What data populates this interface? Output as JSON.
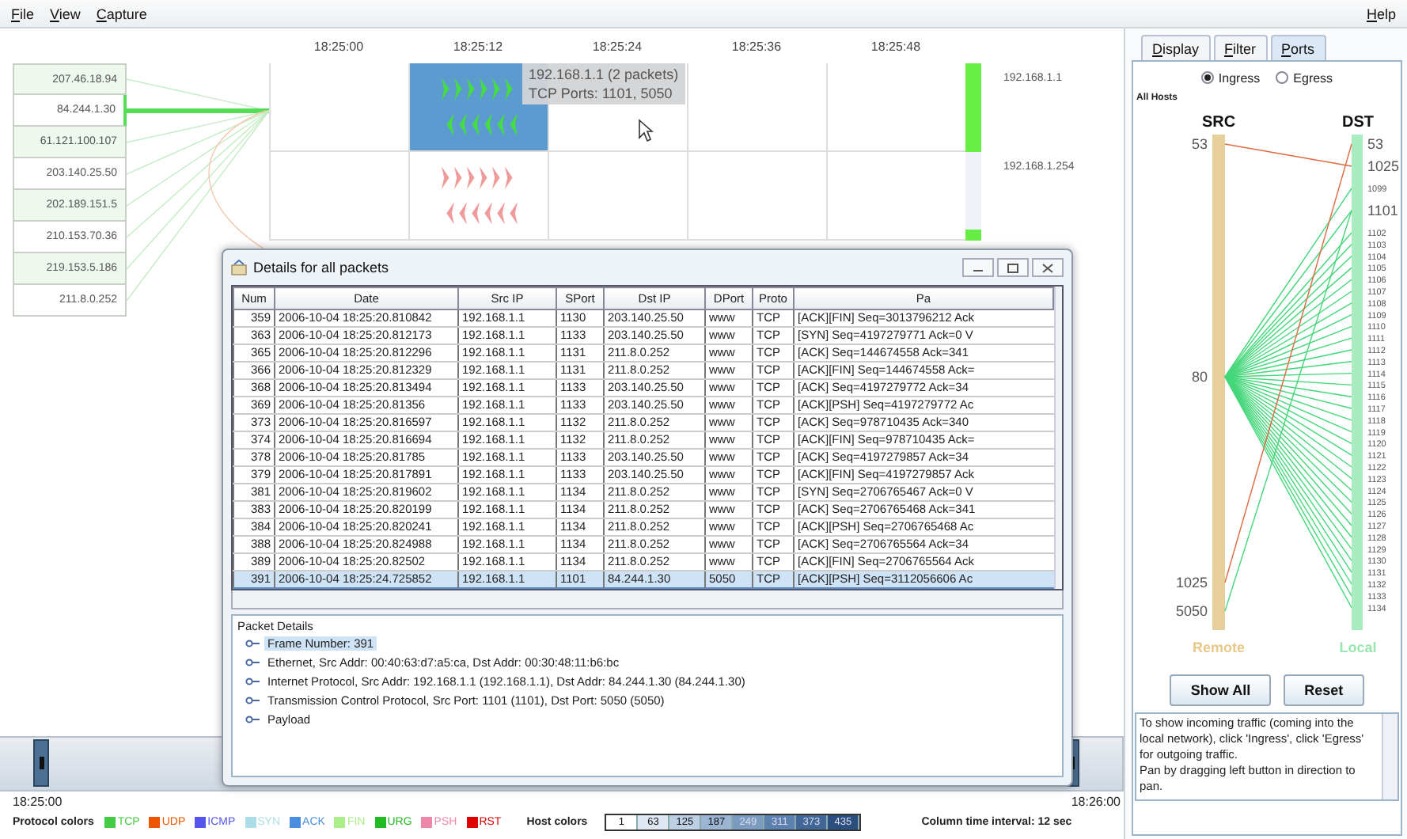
{
  "menu": [
    {
      "label": "File"
    },
    {
      "label": "View"
    },
    {
      "label": "Capture"
    }
  ],
  "help_menu": "Help",
  "hosts_list": [
    {
      "ip": "207.46.18.94",
      "selected": false
    },
    {
      "ip": "84.244.1.30",
      "selected": true
    },
    {
      "ip": "61.121.100.107",
      "selected": false
    },
    {
      "ip": "203.140.25.50",
      "selected": false
    },
    {
      "ip": "202.189.151.5",
      "selected": false
    },
    {
      "ip": "210.153.70.36",
      "selected": false
    },
    {
      "ip": "219.153.5.186",
      "selected": false
    },
    {
      "ip": "211.8.0.252",
      "selected": false
    }
  ],
  "timeline": {
    "time_labels": [
      "18:25:00",
      "18:25:12",
      "18:25:24",
      "18:25:36",
      "18:25:48"
    ],
    "tooltip": [
      "192.168.1.1  (2 packets)",
      "TCP Ports: 1101, 5050"
    ],
    "hosts": [
      {
        "label": "192.168.1.1",
        "color": "#44dd44",
        "level": 1,
        "cells": [
          {
            "kind": "empty",
            "highlighted": false
          },
          {
            "kind": "glyphs",
            "highlighted": true
          },
          {
            "kind": "empty",
            "highlighted": false
          },
          {
            "kind": "empty",
            "highlighted": false
          },
          {
            "kind": "empty",
            "highlighted": false
          }
        ]
      },
      {
        "label": "192.168.1.254",
        "color": "#f09a9a",
        "level": 0.12,
        "cells": [
          {
            "kind": "empty",
            "highlighted": false
          },
          {
            "kind": "glyphs",
            "highlighted": false
          },
          {
            "kind": "empty",
            "highlighted": false
          },
          {
            "kind": "empty",
            "highlighted": false
          },
          {
            "kind": "empty",
            "highlighted": false
          }
        ]
      }
    ]
  },
  "ports_panel": {
    "tabs": [
      {
        "label": "Display",
        "selected": false
      },
      {
        "label": "Filter",
        "selected": false
      },
      {
        "label": "Ports",
        "selected": true
      }
    ],
    "modes": [
      {
        "label": "Ingress",
        "selected": true
      },
      {
        "label": "Egress",
        "selected": false
      }
    ],
    "scope": "All Hosts",
    "src_title": "SRC",
    "dst_title": "DST",
    "src_caption": "Remote",
    "dst_caption": "Local",
    "src_ports": [
      "53",
      "80",
      "1025",
      "5050"
    ],
    "dst_ports": [
      {
        "label": "53",
        "major": true
      },
      {
        "label": "1025",
        "major": true
      },
      {
        "label": "1099",
        "major": false
      },
      {
        "label": "1101",
        "major": true
      },
      {
        "label": "1102",
        "major": false
      },
      {
        "label": "1103",
        "major": false
      },
      {
        "label": "1104",
        "major": false
      },
      {
        "label": "1105",
        "major": false
      },
      {
        "label": "1106",
        "major": false
      },
      {
        "label": "1107",
        "major": false
      },
      {
        "label": "1108",
        "major": false
      },
      {
        "label": "1109",
        "major": false
      },
      {
        "label": "1110",
        "major": false
      },
      {
        "label": "1111",
        "major": false
      },
      {
        "label": "1112",
        "major": false
      },
      {
        "label": "1113",
        "major": false
      },
      {
        "label": "1114",
        "major": false
      },
      {
        "label": "1115",
        "major": false
      },
      {
        "label": "1116",
        "major": false
      },
      {
        "label": "1117",
        "major": false
      },
      {
        "label": "1118",
        "major": false
      },
      {
        "label": "1119",
        "major": false
      },
      {
        "label": "1120",
        "major": false
      },
      {
        "label": "1121",
        "major": false
      },
      {
        "label": "1122",
        "major": false
      },
      {
        "label": "1123",
        "major": false
      },
      {
        "label": "1124",
        "major": false
      },
      {
        "label": "1125",
        "major": false
      },
      {
        "label": "1126",
        "major": false
      },
      {
        "label": "1127",
        "major": false
      },
      {
        "label": "1128",
        "major": false
      },
      {
        "label": "1129",
        "major": false
      },
      {
        "label": "1130",
        "major": false
      },
      {
        "label": "1131",
        "major": false
      },
      {
        "label": "1132",
        "major": false
      },
      {
        "label": "1133",
        "major": false
      },
      {
        "label": "1134",
        "major": false
      }
    ],
    "buttons": [
      "Show All",
      "Reset"
    ],
    "help": [
      "To show incoming traffic (coming into the local network), click 'Ingress', click 'Egress' for outgoing traffic.",
      "Pan by dragging left button in direction to pan."
    ]
  },
  "dialog": {
    "title": "Details for all packets",
    "columns": [
      "Num",
      "Date",
      "Src IP",
      "SPort",
      "Dst IP",
      "DPort",
      "Proto",
      "Pa"
    ],
    "rows": [
      {
        "cells": [
          "359",
          "2006-10-04 18:25:20.810842",
          "192.168.1.1",
          "1130",
          "203.140.25.50",
          "www",
          "TCP",
          "[ACK][FIN] Seq=3013796212 Ack"
        ],
        "selected": false
      },
      {
        "cells": [
          "363",
          "2006-10-04 18:25:20.812173",
          "192.168.1.1",
          "1133",
          "203.140.25.50",
          "www",
          "TCP",
          "[SYN] Seq=4197279771 Ack=0 V"
        ],
        "selected": false
      },
      {
        "cells": [
          "365",
          "2006-10-04 18:25:20.812296",
          "192.168.1.1",
          "1131",
          "211.8.0.252",
          "www",
          "TCP",
          "[ACK] Seq=144674558 Ack=341"
        ],
        "selected": false
      },
      {
        "cells": [
          "366",
          "2006-10-04 18:25:20.812329",
          "192.168.1.1",
          "1131",
          "211.8.0.252",
          "www",
          "TCP",
          "[ACK][FIN] Seq=144674558 Ack="
        ],
        "selected": false
      },
      {
        "cells": [
          "368",
          "2006-10-04 18:25:20.813494",
          "192.168.1.1",
          "1133",
          "203.140.25.50",
          "www",
          "TCP",
          "[ACK] Seq=4197279772 Ack=34"
        ],
        "selected": false
      },
      {
        "cells": [
          "369",
          "2006-10-04 18:25:20.81356",
          "192.168.1.1",
          "1133",
          "203.140.25.50",
          "www",
          "TCP",
          "[ACK][PSH] Seq=4197279772 Ac"
        ],
        "selected": false
      },
      {
        "cells": [
          "373",
          "2006-10-04 18:25:20.816597",
          "192.168.1.1",
          "1132",
          "211.8.0.252",
          "www",
          "TCP",
          "[ACK] Seq=978710435 Ack=340"
        ],
        "selected": false
      },
      {
        "cells": [
          "374",
          "2006-10-04 18:25:20.816694",
          "192.168.1.1",
          "1132",
          "211.8.0.252",
          "www",
          "TCP",
          "[ACK][FIN] Seq=978710435 Ack="
        ],
        "selected": false
      },
      {
        "cells": [
          "378",
          "2006-10-04 18:25:20.81785",
          "192.168.1.1",
          "1133",
          "203.140.25.50",
          "www",
          "TCP",
          "[ACK] Seq=4197279857 Ack=34"
        ],
        "selected": false
      },
      {
        "cells": [
          "379",
          "2006-10-04 18:25:20.817891",
          "192.168.1.1",
          "1133",
          "203.140.25.50",
          "www",
          "TCP",
          "[ACK][FIN] Seq=4197279857 Ack"
        ],
        "selected": false
      },
      {
        "cells": [
          "381",
          "2006-10-04 18:25:20.819602",
          "192.168.1.1",
          "1134",
          "211.8.0.252",
          "www",
          "TCP",
          "[SYN] Seq=2706765467 Ack=0 V"
        ],
        "selected": false
      },
      {
        "cells": [
          "383",
          "2006-10-04 18:25:20.820199",
          "192.168.1.1",
          "1134",
          "211.8.0.252",
          "www",
          "TCP",
          "[ACK] Seq=2706765468 Ack=341"
        ],
        "selected": false
      },
      {
        "cells": [
          "384",
          "2006-10-04 18:25:20.820241",
          "192.168.1.1",
          "1134",
          "211.8.0.252",
          "www",
          "TCP",
          "[ACK][PSH] Seq=2706765468 Ac"
        ],
        "selected": false
      },
      {
        "cells": [
          "388",
          "2006-10-04 18:25:20.824988",
          "192.168.1.1",
          "1134",
          "211.8.0.252",
          "www",
          "TCP",
          "[ACK] Seq=2706765564 Ack=34"
        ],
        "selected": false
      },
      {
        "cells": [
          "389",
          "2006-10-04 18:25:20.82502",
          "192.168.1.1",
          "1134",
          "211.8.0.252",
          "www",
          "TCP",
          "[ACK][FIN] Seq=2706765564 Ack"
        ],
        "selected": false
      },
      {
        "cells": [
          "391",
          "2006-10-04 18:25:24.725852",
          "192.168.1.1",
          "1101",
          "84.244.1.30",
          "5050",
          "TCP",
          "[ACK][PSH] Seq=3112056606 Ac"
        ],
        "selected": true
      }
    ],
    "details_title": "Packet Details",
    "details": [
      {
        "label": "Frame Number: 391",
        "selected": true
      },
      {
        "label": "Ethernet, Src Addr: 00:40:63:d7:a5:ca, Dst Addr: 00:30:48:11:b6:bc",
        "selected": false
      },
      {
        "label": "Internet Protocol, Src Addr: 192.168.1.1 (192.168.1.1), Dst Addr: 84.244.1.30 (84.244.1.30)",
        "selected": false
      },
      {
        "label": "Transmission Control Protocol, Src Port: 1101 (1101), Dst Port: 5050 (5050)",
        "selected": false
      },
      {
        "label": "Payload",
        "selected": false
      }
    ]
  },
  "range": {
    "start": "18:25:00",
    "end": "18:26:00",
    "handles": [
      {
        "level": 0.03
      },
      {
        "level": 0.96
      }
    ]
  },
  "legend": {
    "protocol_title": "Protocol colors",
    "protocols": [
      {
        "label": "TCP",
        "color": "#44cc44"
      },
      {
        "label": "UDP",
        "color": "#ee5500"
      },
      {
        "label": "ICMP",
        "color": "#5555ee"
      },
      {
        "label": "SYN",
        "color": "#aadde8"
      },
      {
        "label": "ACK",
        "color": "#4a8ee0"
      },
      {
        "label": "FIN",
        "color": "#aaee88"
      },
      {
        "label": "URG",
        "color": "#22bb22"
      },
      {
        "label": "PSH",
        "color": "#ee88aa"
      },
      {
        "label": "RST",
        "color": "#dd0000"
      }
    ],
    "host_title": "Host colors",
    "host_scale": [
      {
        "label": "1",
        "color": "#ffffff"
      },
      {
        "label": "63",
        "color": "#dfe8f2"
      },
      {
        "label": "125",
        "color": "#bccfe3"
      },
      {
        "label": "187",
        "color": "#9bb5d2"
      },
      {
        "label": "249",
        "color": "#7b9bc1"
      },
      {
        "label": "311",
        "color": "#5d81ae"
      },
      {
        "label": "373",
        "color": "#416797"
      },
      {
        "label": "435",
        "color": "#2a4f7e"
      }
    ],
    "interval": "Column time interval: 12 sec"
  }
}
